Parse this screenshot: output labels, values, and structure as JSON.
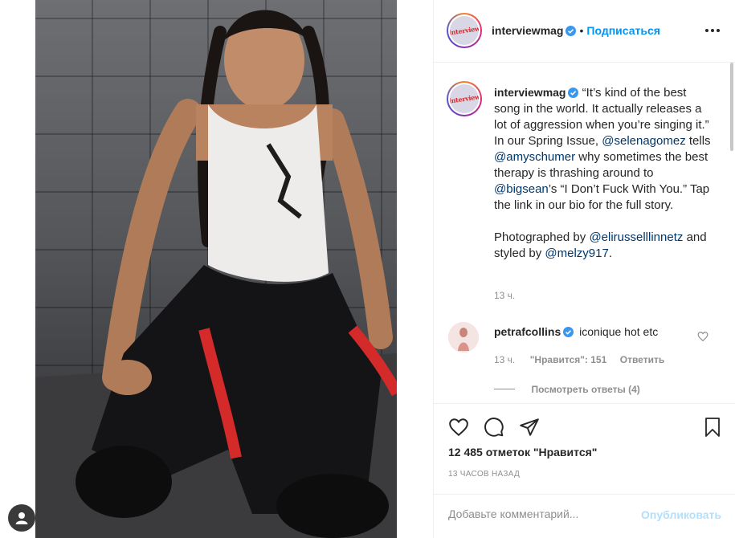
{
  "post": {
    "author": "interviewmag",
    "follow_label": "Подписаться",
    "more_icon": "more-horizontal-icon",
    "caption_parts": {
      "p1": "“It’s kind of the best song in the world. It actually releases a lot of aggression when you’re singing it.” In our Spring Issue,",
      "m1": "@selenagomez",
      "p2": "tells",
      "m2": "@amyschumer",
      "p3": "why sometimes the best therapy is thrashing around to",
      "m3": "@bigsean",
      "p4": "’s “I Don’t Fuck With You.” Tap the link in our bio for the full story.",
      "p5": "Photographed by",
      "m4": "@elirusselllinnetz",
      "p6": "and styled by",
      "m5": "@melzy917",
      "p7": "."
    },
    "caption_time": "13 ч."
  },
  "comment": {
    "author": "petrafcollins",
    "text": "iconique hot etc",
    "time": "13 ч.",
    "likes": "\"Нравится\": 151",
    "reply_label": "Ответить",
    "view_replies": "Посмотреть ответы (4)"
  },
  "actions": {
    "likes_count": "12 485 отметок \"Нравится\"",
    "time_ago": "13 ЧАСОВ НАЗАД"
  },
  "add_comment": {
    "placeholder": "Добавьте комментарий...",
    "publish_label": "Опубликовать"
  },
  "colors": {
    "accent": "#0095f6",
    "mention": "#00376b",
    "muted": "#8e8e8e",
    "publish_disabled": "#b2dffc"
  }
}
